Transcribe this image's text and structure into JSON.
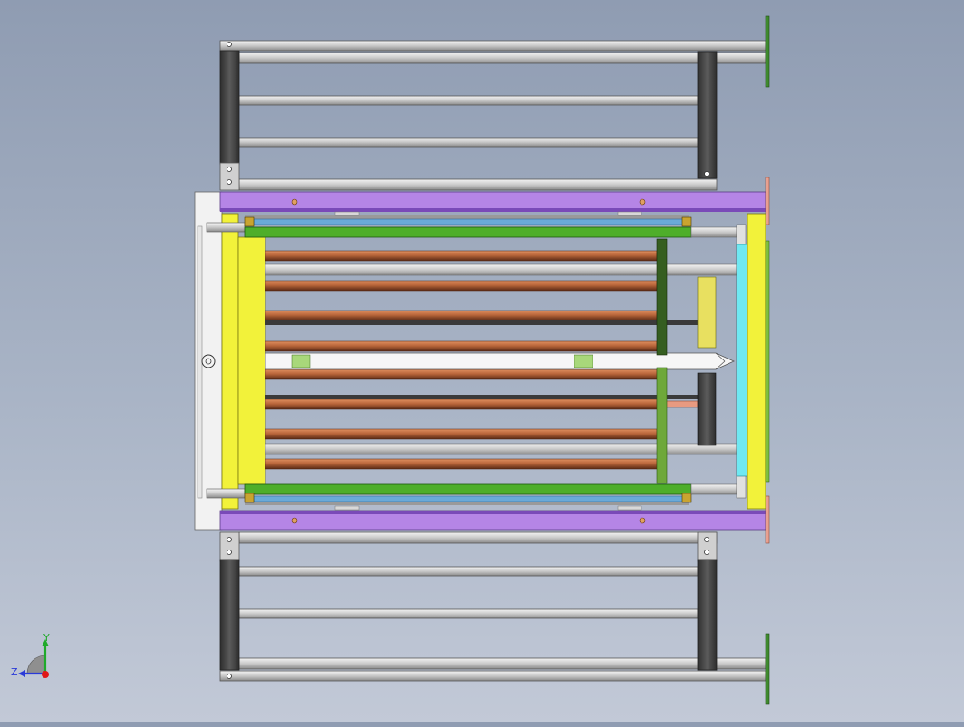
{
  "viewport": {
    "view_orientation": "top",
    "triad": {
      "axis_y_label": "Y",
      "axis_z_label": "Z"
    }
  },
  "colors": {
    "background_top": "#8f9cb2",
    "background_bottom": "#c2c9d7",
    "frame_dark": "#4a4a4a",
    "rail_light": "#e4e4e4",
    "purple_beam": "#b585e6",
    "yellow_plate": "#f2f23a",
    "green_bar": "#4eae2a",
    "copper_rod": "#b8653a",
    "cyan_plate": "#6fe8f2",
    "olive_green": "#7fbf3f"
  }
}
